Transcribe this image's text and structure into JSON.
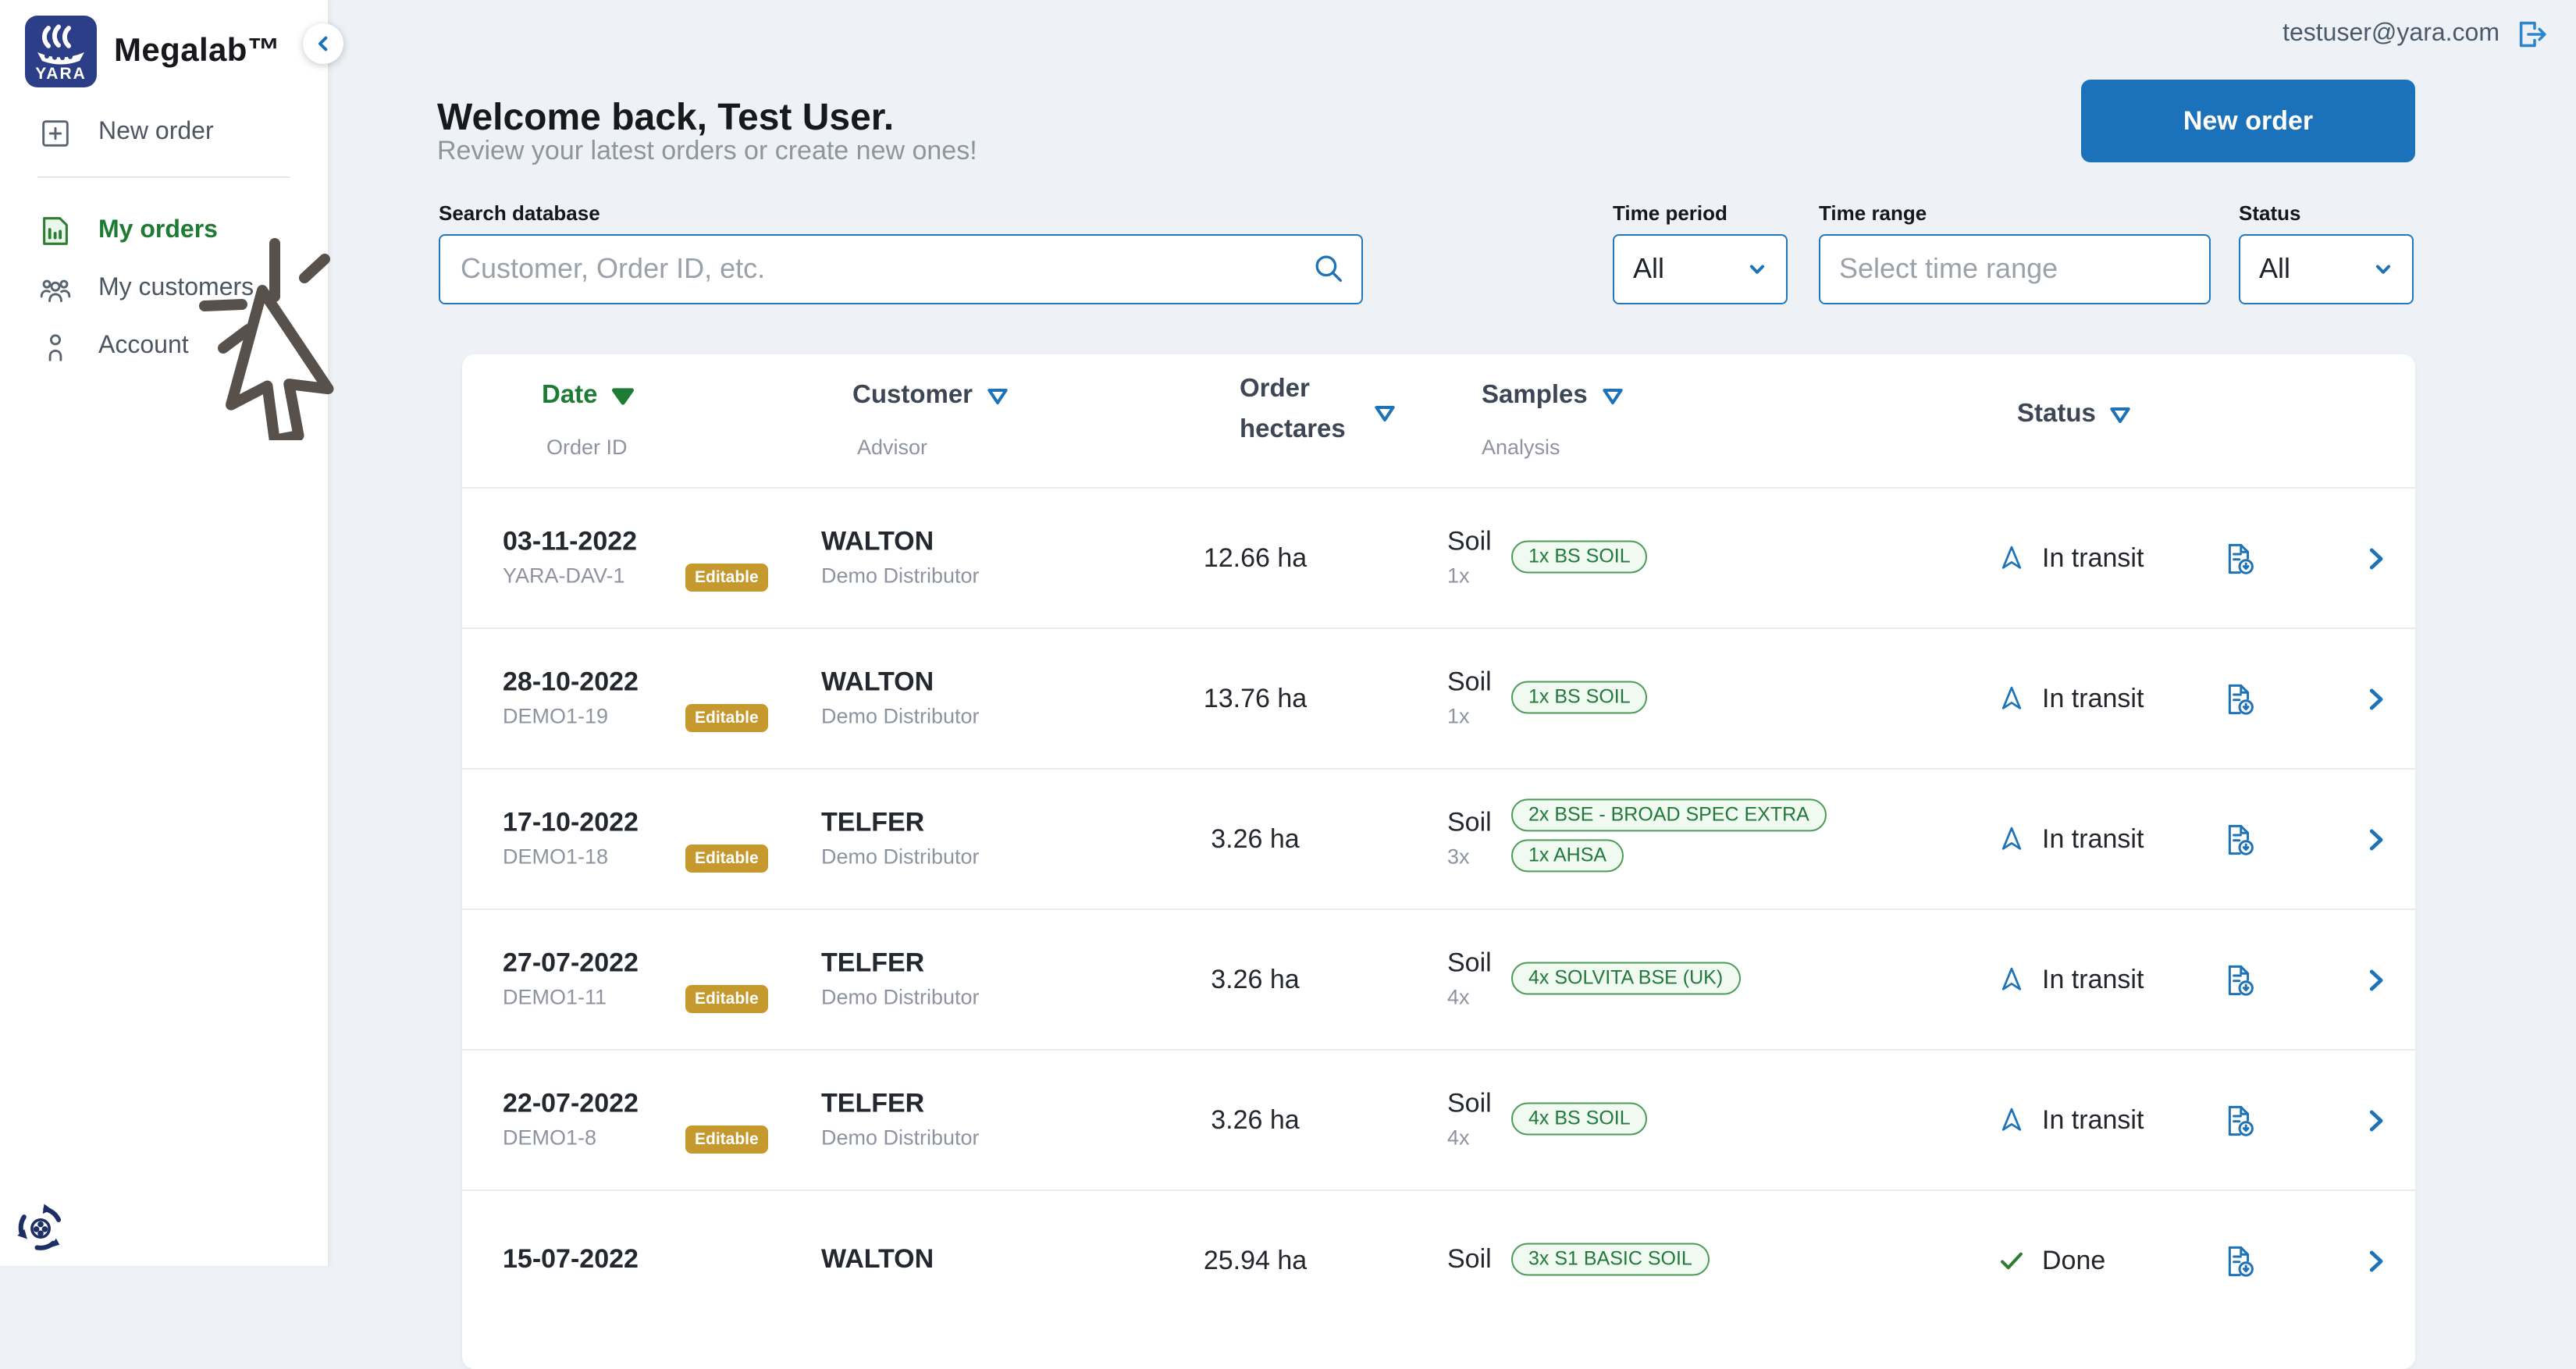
{
  "brand": {
    "name": "Megalab™",
    "logo_text": "YARA"
  },
  "topbar": {
    "user_email": "testuser@yara.com"
  },
  "sidebar": {
    "items": [
      {
        "label": "New order",
        "active": false
      },
      {
        "label": "My orders",
        "active": true
      },
      {
        "label": "My customers",
        "active": false
      },
      {
        "label": "Account",
        "active": false
      }
    ]
  },
  "header": {
    "title": "Welcome back, Test User.",
    "subtitle": "Review your latest orders or create new ones!",
    "new_order_button": "New order"
  },
  "filters": {
    "search": {
      "label": "Search database",
      "placeholder": "Customer, Order ID, etc."
    },
    "time_period": {
      "label": "Time period",
      "value": "All"
    },
    "time_range": {
      "label": "Time range",
      "placeholder": "Select time range"
    },
    "status": {
      "label": "Status",
      "value": "All"
    }
  },
  "table": {
    "columns": {
      "date": "Date",
      "date_sub": "Order ID",
      "customer": "Customer",
      "customer_sub": "Advisor",
      "hectares": "Order hectares",
      "samples": "Samples",
      "samples_sub": "Analysis",
      "status": "Status"
    },
    "rows": [
      {
        "date": "03-11-2022",
        "order_id": "YARA-DAV-1",
        "badge": "Editable",
        "customer": "WALTON",
        "advisor": "Demo Distributor",
        "hectares": "12.66 ha",
        "sample_type": "Soil",
        "sample_count": "1x",
        "analyses": [
          "1x BS SOIL"
        ],
        "status": "In transit",
        "status_type": "transit"
      },
      {
        "date": "28-10-2022",
        "order_id": "DEMO1-19",
        "badge": "Editable",
        "customer": "WALTON",
        "advisor": "Demo Distributor",
        "hectares": "13.76 ha",
        "sample_type": "Soil",
        "sample_count": "1x",
        "analyses": [
          "1x BS SOIL"
        ],
        "status": "In transit",
        "status_type": "transit"
      },
      {
        "date": "17-10-2022",
        "order_id": "DEMO1-18",
        "badge": "Editable",
        "customer": "TELFER",
        "advisor": "Demo Distributor",
        "hectares": "3.26 ha",
        "sample_type": "Soil",
        "sample_count": "3x",
        "analyses": [
          "2x BSE - BROAD SPEC EXTRA",
          "1x AHSA"
        ],
        "status": "In transit",
        "status_type": "transit"
      },
      {
        "date": "27-07-2022",
        "order_id": "DEMO1-11",
        "badge": "Editable",
        "customer": "TELFER",
        "advisor": "Demo Distributor",
        "hectares": "3.26 ha",
        "sample_type": "Soil",
        "sample_count": "4x",
        "analyses": [
          "4x SOLVITA BSE (UK)"
        ],
        "status": "In transit",
        "status_type": "transit"
      },
      {
        "date": "22-07-2022",
        "order_id": "DEMO1-8",
        "badge": "Editable",
        "customer": "TELFER",
        "advisor": "Demo Distributor",
        "hectares": "3.26 ha",
        "sample_type": "Soil",
        "sample_count": "4x",
        "analyses": [
          "4x BS SOIL"
        ],
        "status": "In transit",
        "status_type": "transit"
      },
      {
        "date": "15-07-2022",
        "order_id": "",
        "badge": "",
        "customer": "WALTON",
        "advisor": "",
        "hectares": "25.94 ha",
        "sample_type": "Soil",
        "sample_count": "",
        "analyses": [
          "3x S1 BASIC SOIL"
        ],
        "status": "Done",
        "status_type": "done"
      }
    ]
  },
  "colors": {
    "accent_blue": "#1d72b8",
    "button_blue": "#1c72ba",
    "brand_navy": "#2c3e87",
    "active_green": "#1e7b34",
    "badge_gold": "#c6992f",
    "chip_border": "#4c9b57",
    "chip_bg": "#f1faf1",
    "page_bg": "#eef2f6",
    "done_green": "#2e7d32"
  }
}
